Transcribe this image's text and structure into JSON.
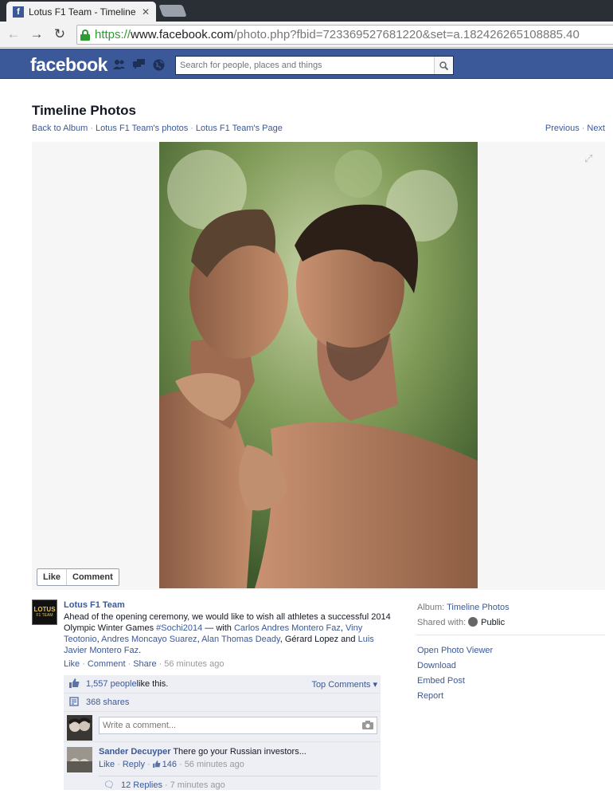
{
  "browser": {
    "tab_title": "Lotus F1 Team - Timeline",
    "url_scheme": "https://",
    "url_host": "www.facebook.com",
    "url_path": "/photo.php?fbid=723369527681220&set=a.182426265108885.40"
  },
  "fb": {
    "logo": "facebook",
    "search_placeholder": "Search for people, places and things"
  },
  "page": {
    "title": "Timeline Photos",
    "crumbs": [
      "Back to Album",
      "Lotus F1 Team's photos",
      "Lotus F1 Team's Page"
    ],
    "previous": "Previous",
    "next": "Next"
  },
  "photo_actions": {
    "like": "Like",
    "comment": "Comment"
  },
  "post": {
    "page_name": "Lotus F1 Team",
    "avatar_line1": "LOTUS",
    "avatar_line2": "F1 TEAM",
    "caption_text": "Ahead of the opening ceremony, we would like to wish all athletes a successful 2014 Olympic Winter Games ",
    "hashtag": "#Sochi2014",
    "with_prefix": " — with ",
    "tags": [
      "Carlos Andres Montero Faz",
      "Viny Teotonio",
      "Andres Moncayo Suarez",
      "Alan Thomas Deady"
    ],
    "plain_name": "Gérard Lopez",
    "and_word": " and ",
    "last_tag": "Luis Javier Montero Faz",
    "end": ".",
    "actions": {
      "like": "Like",
      "comment": "Comment",
      "share": "Share",
      "time": "56 minutes ago"
    }
  },
  "ufi": {
    "likes": "1,557 people",
    "likes_suffix": " like this.",
    "top_comments": "Top Comments ▾",
    "shares": "368 shares",
    "comment_placeholder": "Write a comment...",
    "comment": {
      "author": "Sander Decuyper",
      "text": " There go your Russian investors...",
      "like": "Like",
      "reply": "Reply",
      "like_count": "146",
      "time": "56 minutes ago",
      "replies": "12 Replies",
      "replies_time": "7 minutes ago"
    }
  },
  "sidebar": {
    "album_label": "Album:",
    "album_value": "Timeline Photos",
    "shared_label": "Shared with:",
    "shared_value": "Public",
    "links": [
      "Open Photo Viewer",
      "Download",
      "Embed Post",
      "Report"
    ]
  },
  "colors": {
    "fb_blue": "#3b5998",
    "link": "#3b5998",
    "ssl_green": "#2e9b30"
  }
}
